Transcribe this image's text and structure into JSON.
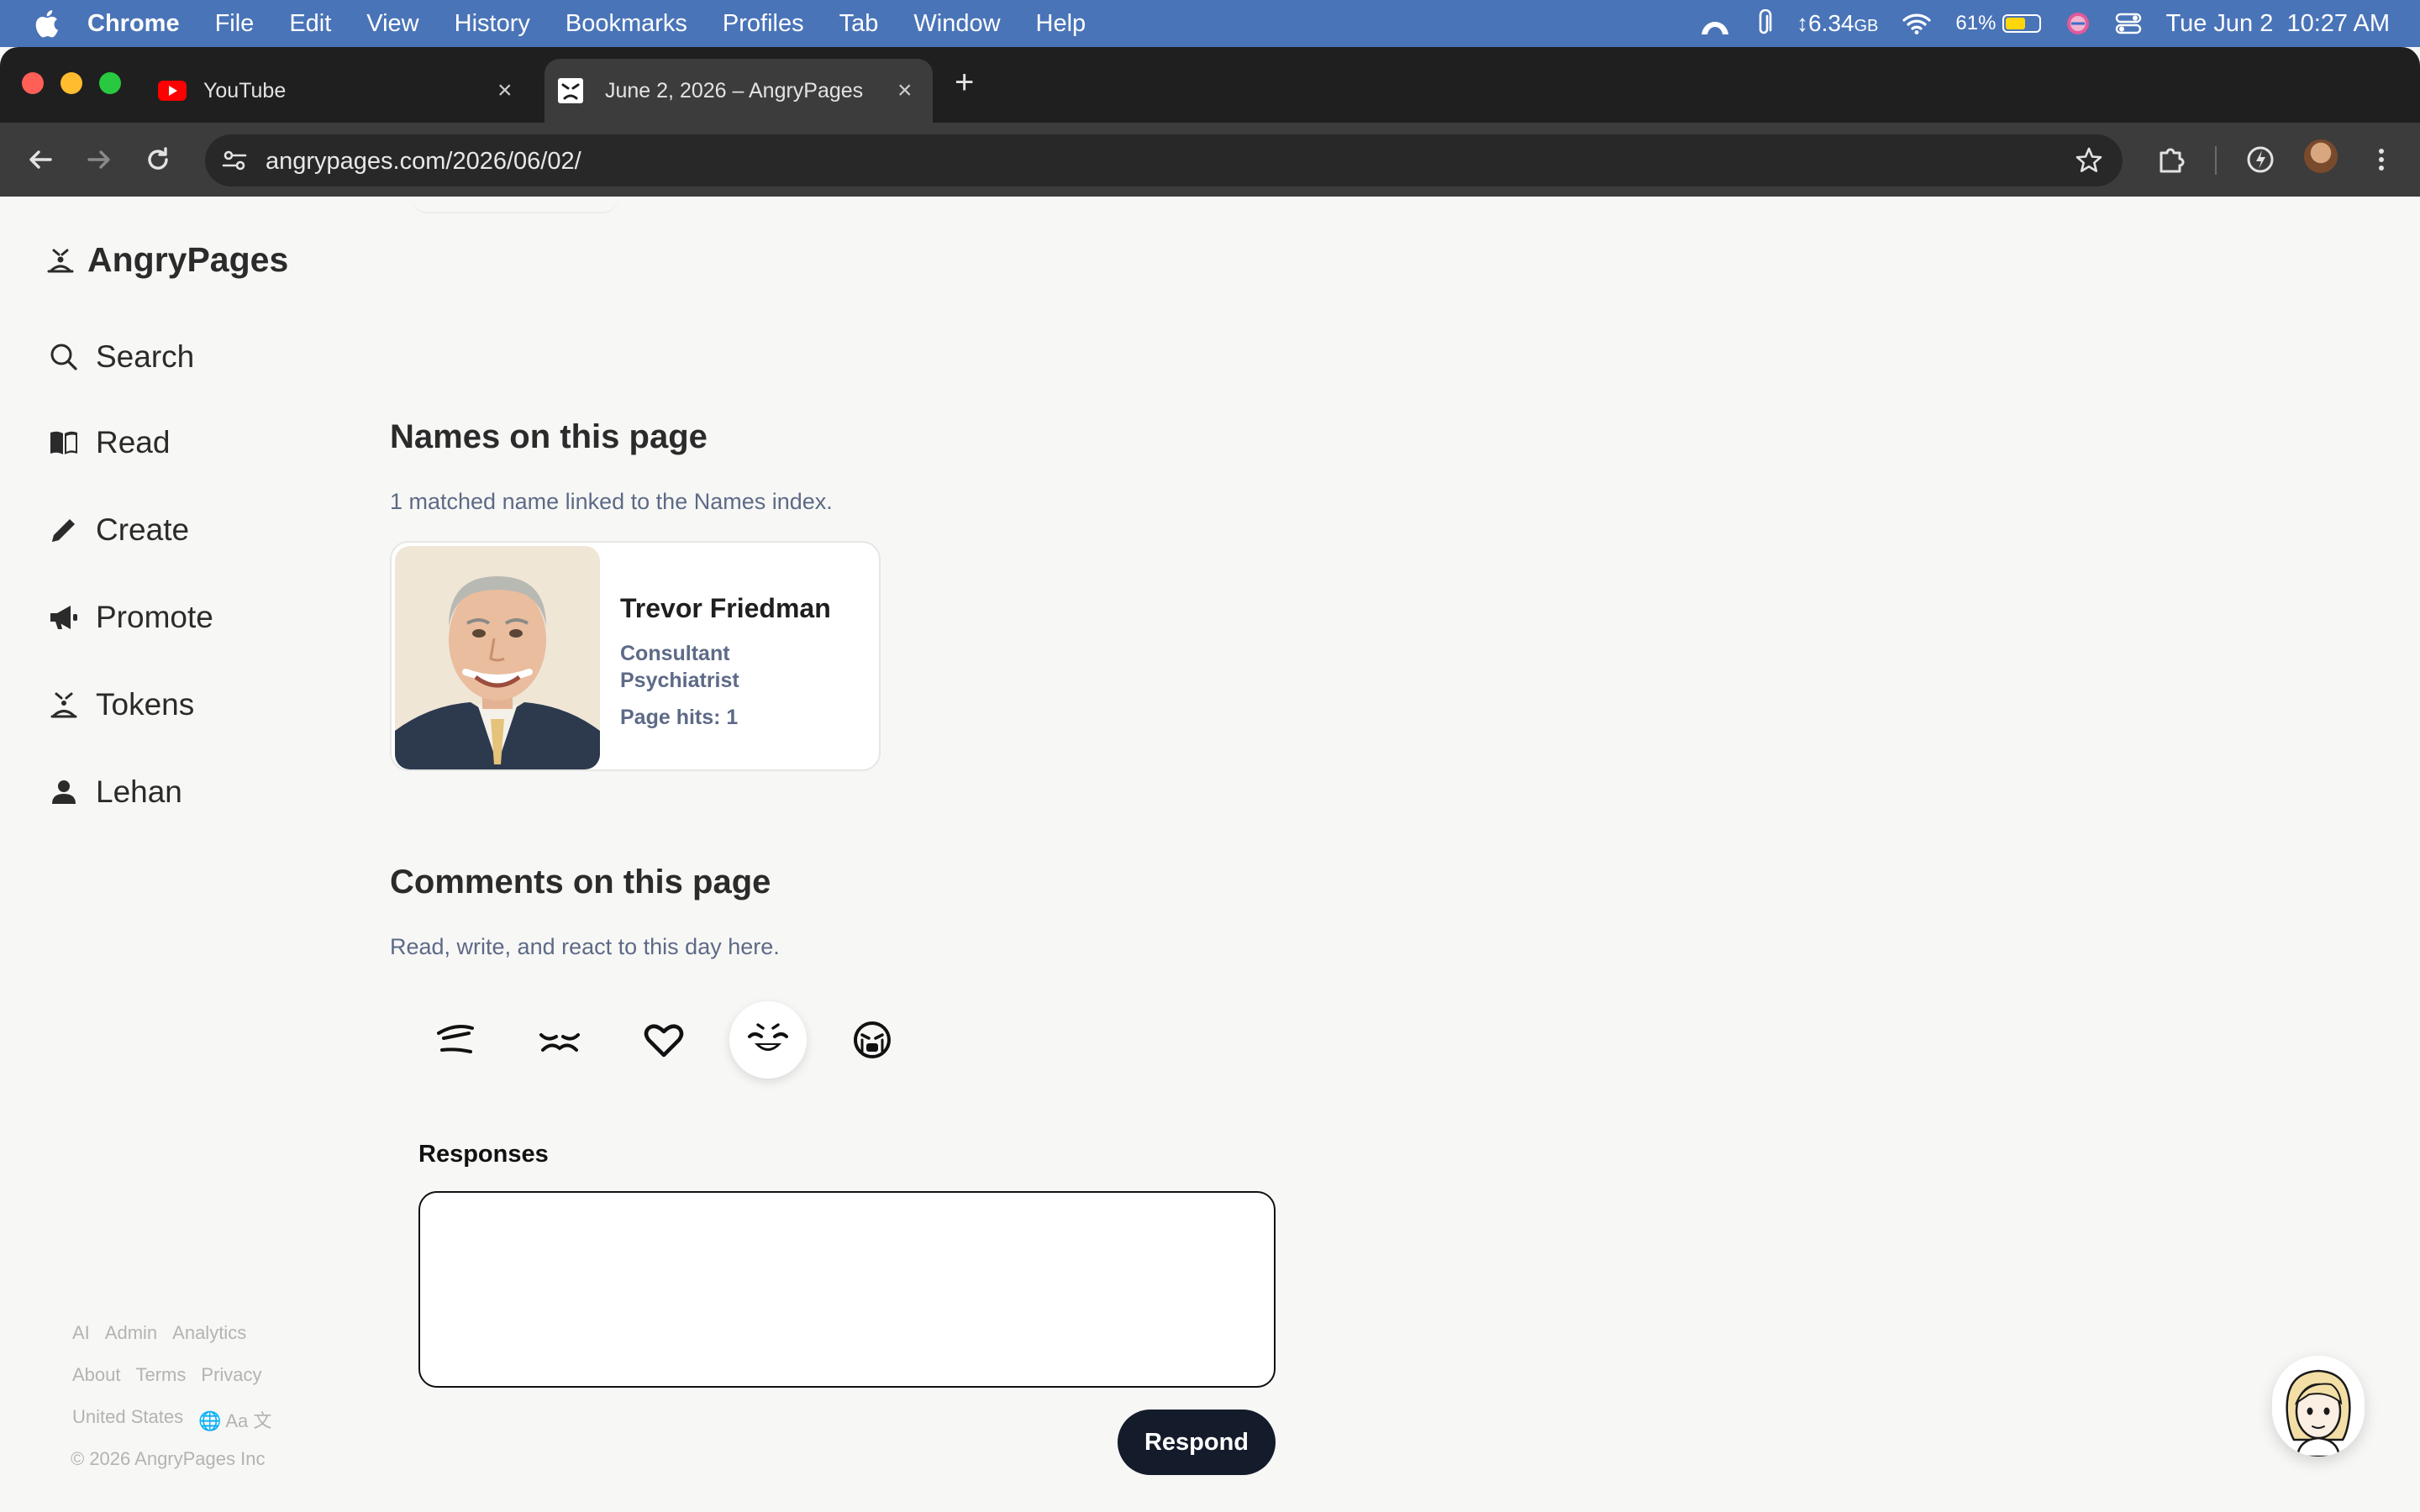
{
  "menubar": {
    "app_name": "Chrome",
    "items": [
      "File",
      "Edit",
      "View",
      "History",
      "Bookmarks",
      "Profiles",
      "Tab",
      "Window",
      "Help"
    ],
    "memory": "6.34",
    "memory_unit": "GB",
    "battery_percent": "61%",
    "battery_level": 0.61,
    "datetime": "Tue Jun 2  10:27 AM"
  },
  "tabs": [
    {
      "title": "YouTube",
      "icon": "youtube-icon",
      "active": false
    },
    {
      "title": "June 2, 2026 – AngryPages",
      "icon": "angrypages-favicon",
      "active": true
    }
  ],
  "toolbar": {
    "url": "angrypages.com/2026/06/02/"
  },
  "sidebar": {
    "brand": "AngryPages",
    "items": [
      {
        "label": "Search",
        "icon": "search-icon"
      },
      {
        "label": "Read",
        "icon": "book-icon"
      },
      {
        "label": "Create",
        "icon": "pencil-icon"
      },
      {
        "label": "Promote",
        "icon": "megaphone-icon"
      },
      {
        "label": "Tokens",
        "icon": "token-face-icon"
      },
      {
        "label": "Lehan",
        "icon": "user-icon"
      }
    ],
    "footer_row1": [
      "AI",
      "Admin",
      "Analytics"
    ],
    "footer_row2": [
      "About",
      "Terms",
      "Privacy"
    ],
    "footer_row3": [
      "United States",
      "🌐 Aa 文"
    ],
    "copyright": "© 2026 AngryPages Inc"
  },
  "names_section": {
    "heading": "Names on this page",
    "subtitle": "1 matched name linked to the Names index.",
    "person": {
      "name": "Trevor Friedman",
      "role": "Consultant Psychiatrist",
      "hits": "Page hits: 1"
    }
  },
  "comments_section": {
    "heading": "Comments on this page",
    "subtitle": "Read, write, and react to this day here.",
    "reactions": [
      "annoyed-face-icon",
      "squint-face-icon",
      "heart-icon",
      "laughing-face-icon",
      "crying-face-icon"
    ],
    "selected_reaction": "laughing-face-icon",
    "responses_label": "Responses",
    "response_value": "",
    "respond_button": "Respond"
  }
}
